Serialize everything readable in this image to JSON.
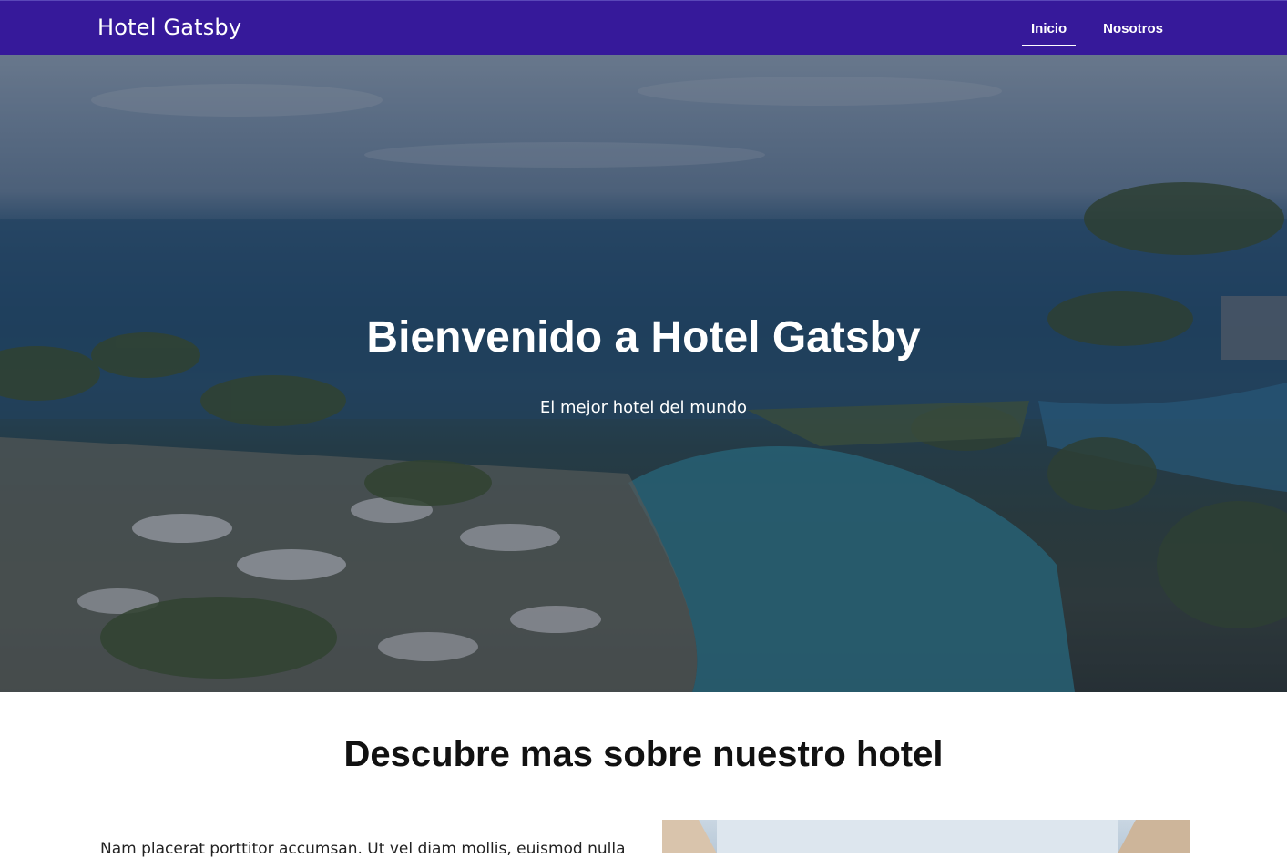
{
  "nav": {
    "brand": "Hotel Gatsby",
    "links": [
      {
        "label": "Inicio",
        "active": true
      },
      {
        "label": "Nosotros",
        "active": false
      }
    ],
    "background": "#36199a"
  },
  "hero": {
    "title": "Bienvenido a Hotel Gatsby",
    "subtitle": "El mejor hotel del mundo"
  },
  "about": {
    "title": "Descubre mas sobre nuestro hotel",
    "paragraph": "Nam placerat porttitor accumsan. Ut vel diam mollis, euismod nulla"
  }
}
